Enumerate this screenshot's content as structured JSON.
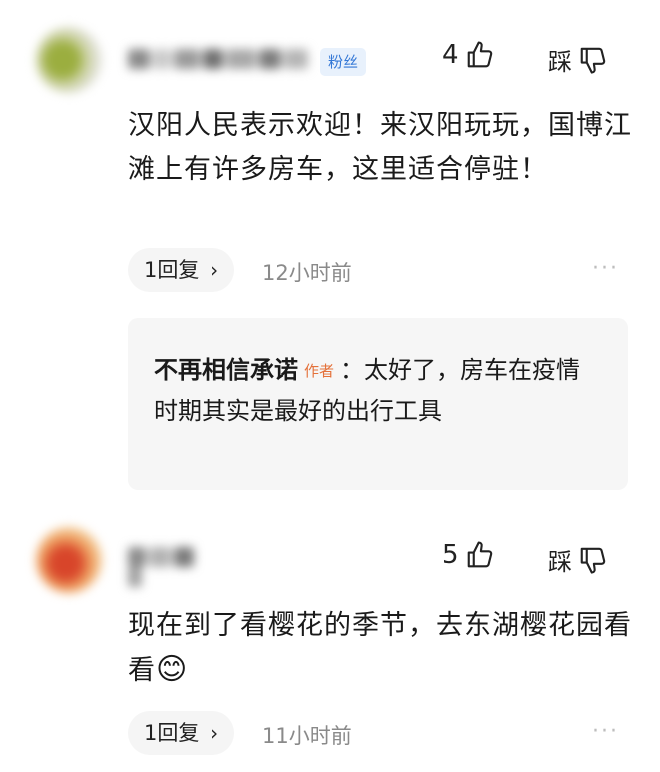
{
  "comments": [
    {
      "username": "G…",
      "fan_badge": "粉丝",
      "like_count": "4",
      "dislike_label": "踩",
      "text": "汉阳人民表示欢迎！来汉阳玩玩，国博江滩上有许多房车，这里适合停驻！",
      "reply_label": "1回复",
      "time": "12小时前",
      "more": "···",
      "sub_reply": {
        "author": "不再相信承诺",
        "author_tag": "作者",
        "separator": "：",
        "text": "太好了，房车在疫情时期其实是最好的出行工具"
      }
    },
    {
      "username": "S…",
      "like_count": "5",
      "dislike_label": "踩",
      "text": "现在到了看樱花的季节，去东湖樱花园看看",
      "emoji": "😊",
      "reply_label": "1回复",
      "time": "11小时前",
      "more": "···"
    }
  ],
  "colors": {
    "badge_bg": "#e8f1fc",
    "badge_text": "#3478d6",
    "author_tag": "#e4713a",
    "time_text": "#8a8a8a",
    "subreply_bg": "#f6f6f6"
  },
  "icons": [
    "thumbs-up-icon",
    "thumbs-down-icon",
    "chevron-right-icon",
    "more-icon"
  ]
}
